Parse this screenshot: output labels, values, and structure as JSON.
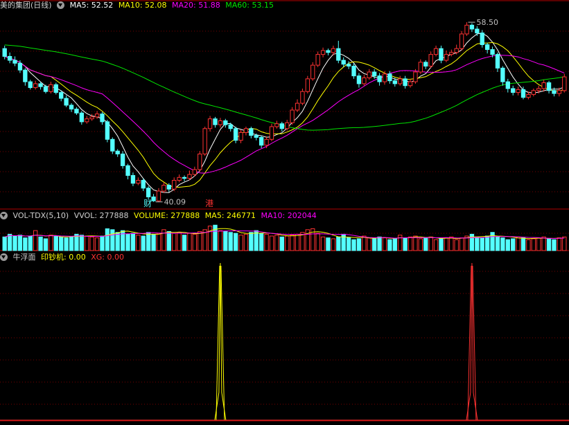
{
  "main_panel": {
    "stock_name": "美的集团(日线)",
    "ma5": "MA5: 52.52",
    "ma10": "MA10: 52.08",
    "ma20": "MA20: 51.88",
    "ma60": "MA60: 53.15",
    "high_label": "58.50",
    "low_label": "40.09",
    "marker_cai": "财",
    "marker_gang": "港"
  },
  "vol_panel": {
    "name": "VOL-TDX(5,10)",
    "vvol": "VVOL: 277888",
    "volume": "VOLUME: 277888",
    "ma5": "MA5: 246771",
    "ma10": "MA10: 202044"
  },
  "ind_panel": {
    "name": "牛浮面",
    "yinchaoji": "印钞机: 0.00",
    "xg": "XG: 0.00"
  },
  "colors": {
    "up": "#ff3232",
    "down": "#54ffff",
    "ma5": "#ffffff",
    "ma10": "#ffff00",
    "ma20": "#ff00ff",
    "ma60": "#00e600",
    "grid": "#7a0000",
    "border": "#b40000"
  },
  "chart_data": [
    {
      "type": "candlestick",
      "title": "美的集团(日线)",
      "price_range": [
        39.5,
        59.5
      ],
      "high": 58.5,
      "low": 40.09,
      "candles": [
        [
          55.8,
          55.0,
          56.1,
          54.7
        ],
        [
          55.0,
          54.6,
          55.4,
          54.3
        ],
        [
          54.6,
          54.3,
          55.0,
          54.0
        ],
        [
          54.3,
          53.6,
          54.6,
          53.3
        ],
        [
          53.6,
          52.4,
          53.8,
          52.0
        ],
        [
          52.4,
          51.8,
          52.6,
          51.6
        ],
        [
          51.8,
          52.2,
          52.5,
          51.6
        ],
        [
          52.2,
          51.9,
          52.4,
          51.6
        ],
        [
          51.9,
          51.4,
          52.1,
          51.2
        ],
        [
          51.4,
          52.1,
          52.4,
          51.2
        ],
        [
          52.1,
          51.3,
          52.3,
          51.1
        ],
        [
          51.3,
          50.7,
          51.5,
          50.4
        ],
        [
          50.7,
          50.0,
          51.0,
          49.8
        ],
        [
          50.0,
          49.6,
          50.2,
          49.3
        ],
        [
          49.6,
          49.2,
          49.8,
          49.0
        ],
        [
          49.2,
          48.3,
          49.4,
          48.0
        ],
        [
          48.3,
          48.6,
          48.9,
          48.1
        ],
        [
          48.6,
          48.8,
          49.1,
          48.4
        ],
        [
          48.8,
          49.1,
          49.4,
          48.6
        ],
        [
          49.1,
          48.3,
          49.3,
          48.0
        ],
        [
          48.3,
          46.5,
          48.5,
          46.2
        ],
        [
          46.5,
          45.3,
          46.7,
          45.0
        ],
        [
          45.3,
          45.0,
          45.5,
          44.7
        ],
        [
          45.0,
          43.8,
          45.3,
          43.5
        ],
        [
          43.8,
          42.8,
          44.0,
          42.4
        ],
        [
          42.8,
          42.0,
          43.1,
          41.7
        ],
        [
          42.0,
          42.3,
          42.6,
          41.8
        ],
        [
          42.3,
          41.5,
          42.5,
          41.2
        ],
        [
          41.5,
          40.6,
          41.7,
          40.3
        ],
        [
          40.6,
          40.2,
          40.9,
          40.09
        ],
        [
          40.2,
          41.2,
          41.5,
          40.1
        ],
        [
          41.2,
          41.8,
          42.1,
          41.0
        ],
        [
          41.8,
          41.4,
          42.0,
          41.1
        ],
        [
          41.4,
          42.3,
          42.6,
          41.2
        ],
        [
          42.3,
          42.6,
          42.9,
          42.1
        ],
        [
          42.6,
          42.5,
          42.8,
          42.2
        ],
        [
          42.5,
          42.9,
          43.3,
          42.3
        ],
        [
          42.9,
          43.4,
          43.7,
          42.7
        ],
        [
          43.4,
          45.0,
          45.3,
          43.2
        ],
        [
          45.0,
          47.6,
          47.8,
          44.8
        ],
        [
          47.6,
          48.6,
          48.9,
          47.3
        ],
        [
          48.6,
          48.0,
          48.8,
          47.7
        ],
        [
          48.0,
          48.4,
          48.7,
          47.7
        ],
        [
          48.4,
          48.0,
          48.6,
          47.7
        ],
        [
          48.0,
          47.6,
          48.2,
          47.3
        ],
        [
          47.6,
          46.4,
          47.8,
          46.1
        ],
        [
          46.4,
          47.2,
          47.5,
          46.1
        ],
        [
          47.2,
          47.6,
          47.8,
          46.9
        ],
        [
          47.6,
          46.9,
          47.8,
          46.6
        ],
        [
          46.9,
          46.7,
          47.1,
          46.4
        ],
        [
          46.7,
          45.9,
          46.9,
          45.6
        ],
        [
          45.9,
          46.5,
          46.8,
          45.6
        ],
        [
          46.5,
          47.8,
          48.1,
          46.3
        ],
        [
          47.8,
          48.1,
          48.4,
          47.6
        ],
        [
          48.1,
          47.6,
          48.3,
          47.3
        ],
        [
          47.6,
          48.2,
          48.5,
          47.4
        ],
        [
          48.2,
          49.5,
          49.8,
          48.0
        ],
        [
          49.5,
          50.2,
          50.6,
          49.3
        ],
        [
          50.2,
          51.4,
          51.7,
          50.0
        ],
        [
          51.4,
          52.7,
          53.0,
          51.2
        ],
        [
          52.7,
          54.1,
          54.4,
          52.5
        ],
        [
          54.1,
          55.2,
          55.5,
          53.9
        ],
        [
          55.2,
          55.6,
          55.9,
          54.9
        ],
        [
          55.6,
          55.4,
          55.8,
          55.1
        ],
        [
          55.4,
          55.8,
          56.1,
          55.1
        ],
        [
          55.8,
          54.6,
          56.6,
          54.3
        ],
        [
          54.6,
          54.2,
          54.9,
          53.9
        ],
        [
          54.2,
          54.0,
          54.5,
          53.7
        ],
        [
          54.0,
          53.0,
          54.3,
          52.7
        ],
        [
          53.0,
          52.2,
          53.3,
          51.8
        ],
        [
          52.2,
          52.8,
          53.1,
          52.0
        ],
        [
          52.8,
          53.4,
          53.7,
          52.6
        ],
        [
          53.4,
          53.0,
          53.7,
          52.7
        ],
        [
          53.0,
          52.4,
          53.3,
          52.0
        ],
        [
          52.4,
          53.2,
          53.5,
          52.1
        ],
        [
          53.2,
          52.5,
          53.5,
          52.2
        ],
        [
          52.5,
          52.2,
          52.8,
          51.9
        ],
        [
          52.2,
          52.7,
          53.0,
          52.0
        ],
        [
          52.7,
          52.0,
          53.0,
          51.7
        ],
        [
          52.0,
          52.4,
          52.7,
          51.8
        ],
        [
          52.4,
          53.4,
          53.7,
          52.2
        ],
        [
          53.4,
          54.4,
          54.7,
          53.2
        ],
        [
          54.4,
          54.0,
          54.6,
          53.7
        ],
        [
          54.0,
          55.2,
          55.5,
          53.8
        ],
        [
          55.2,
          55.8,
          56.1,
          55.0
        ],
        [
          55.8,
          54.6,
          56.1,
          54.3
        ],
        [
          54.6,
          55.2,
          55.6,
          54.4
        ],
        [
          55.2,
          55.4,
          55.7,
          55.0
        ],
        [
          55.4,
          55.8,
          56.2,
          55.2
        ],
        [
          55.8,
          57.3,
          57.6,
          55.6
        ],
        [
          57.3,
          58.2,
          58.5,
          57.1
        ],
        [
          58.2,
          57.8,
          58.4,
          57.5
        ],
        [
          57.8,
          57.4,
          58.1,
          57.1
        ],
        [
          57.4,
          56.2,
          57.7,
          55.9
        ],
        [
          56.2,
          55.7,
          56.4,
          55.3
        ],
        [
          55.7,
          55.2,
          56.0,
          54.9
        ],
        [
          55.2,
          53.8,
          55.4,
          53.4
        ],
        [
          53.8,
          52.4,
          54.0,
          52.0
        ],
        [
          52.4,
          51.7,
          52.7,
          51.3
        ],
        [
          51.7,
          51.3,
          52.0,
          51.0
        ],
        [
          51.3,
          51.6,
          51.9,
          51.0
        ],
        [
          51.6,
          50.8,
          51.9,
          50.6
        ],
        [
          50.8,
          51.1,
          51.4,
          50.6
        ],
        [
          51.1,
          51.5,
          51.7,
          50.9
        ],
        [
          51.5,
          51.7,
          52.0,
          51.2
        ],
        [
          51.7,
          52.3,
          52.6,
          51.4
        ],
        [
          52.3,
          51.5,
          52.5,
          51.2
        ],
        [
          51.5,
          51.2,
          51.8,
          50.9
        ],
        [
          51.2,
          51.5,
          51.8,
          50.9
        ],
        [
          51.5,
          52.9,
          53.2,
          51.3
        ]
      ],
      "ma_lines": [
        "MA5",
        "MA10",
        "MA20",
        "MA60"
      ]
    },
    {
      "type": "bar",
      "title": "VOL-TDX(5,10)",
      "vvol": 277888,
      "ma5": 246771,
      "ma10": 202044,
      "volume": [
        150,
        180,
        160,
        170,
        140,
        160,
        220,
        150,
        130,
        170,
        160,
        150,
        140,
        150,
        180,
        170,
        160,
        150,
        140,
        160,
        240,
        230,
        200,
        220,
        180,
        190,
        170,
        160,
        200,
        180,
        190,
        230,
        210,
        190,
        200,
        170,
        190,
        180,
        210,
        230,
        270,
        280,
        220,
        210,
        200,
        190,
        170,
        180,
        200,
        220,
        190,
        180,
        160,
        170,
        150,
        160,
        170,
        180,
        200,
        230,
        240,
        190,
        150,
        140,
        130,
        150,
        180,
        140,
        120,
        130,
        160,
        140,
        130,
        150,
        140,
        120,
        130,
        170,
        140,
        150,
        160,
        130,
        140,
        150,
        120,
        130,
        140,
        150,
        120,
        140,
        160,
        180,
        150,
        140,
        160,
        200,
        150,
        140,
        120,
        130,
        150,
        140,
        120,
        130,
        140,
        150,
        130,
        120,
        140,
        150
      ],
      "vol_max": 320
    },
    {
      "type": "line",
      "title": "牛浮面",
      "series": [
        {
          "name": "印钞机",
          "color": "#ffff00",
          "spike_index": 42,
          "values_label": "0.00"
        },
        {
          "name": "XG",
          "color": "#ff3232",
          "spike_index": 91,
          "values_label": "0.00"
        }
      ]
    }
  ]
}
